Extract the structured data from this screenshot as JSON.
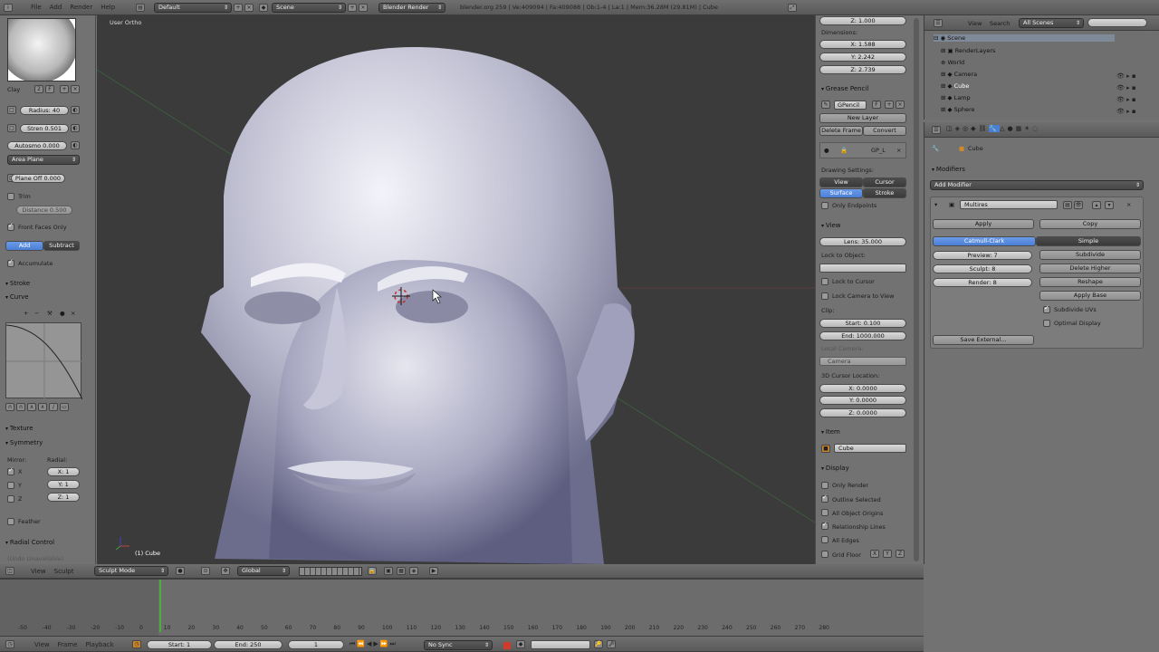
{
  "info_bar": {
    "menus": [
      "File",
      "Add",
      "Render",
      "Help"
    ],
    "layout": "Default",
    "scene": "Scene",
    "engine": "Blender Render",
    "stats": "blender.org 259 | Ve:409094 | Fa:409088 | Ob:1-4 | La:1 | Mem:36.28M (29.81M) | Cube"
  },
  "tool_shelf": {
    "brush": "Clay",
    "brush_users": "2",
    "brush_f": "F",
    "radius": "Radius: 40",
    "strength": "Stren 0.501",
    "autosmooth": "Autosmo 0.000",
    "sculpt_plane": "Area Plane",
    "plane_offset": "Plane Off 0.000",
    "trim": "Trim",
    "trim_distance": "Distance 0.500",
    "front_faces_only": "Front Faces Only",
    "add": "Add",
    "subtract": "Subtract",
    "accumulate": "Accumulate",
    "stroke": "Stroke",
    "curve": "Curve",
    "texture": "Texture",
    "symmetry": "Symmetry",
    "mirror": "Mirror:",
    "radial": "Radial:",
    "axes": [
      "X",
      "Y",
      "Z"
    ],
    "radial_values": [
      "X: 1",
      "Y: 1",
      "Z: 1"
    ],
    "feather": "Feather",
    "radial_control": "Radial Control",
    "undo_hint": "(Undo Unavailable)"
  },
  "viewport": {
    "view_label": "User Ortho",
    "object_label": "(1) Cube"
  },
  "properties": {
    "z_location": "Z: 1.000",
    "dimensions": "Dimensions:",
    "dim_x": "X: 1.588",
    "dim_y": "Y: 2.242",
    "dim_z": "Z: 2.739",
    "grease_pencil": "Grease Pencil",
    "gpencil": "GPencil",
    "gp_f": "F",
    "new_layer": "New Layer",
    "delete_frame": "Delete Frame",
    "convert": "Convert",
    "gp_layer": "GP_L",
    "drawing_settings": "Drawing Settings:",
    "view_btn": "View",
    "cursor_btn": "Cursor",
    "surface_btn": "Surface",
    "stroke_btn": "Stroke",
    "only_endpoints": "Only Endpoints",
    "view_section": "View",
    "lens": "Lens: 35.000",
    "lock_to_object": "Lock to Object:",
    "lock_to_cursor": "Lock to Cursor",
    "lock_camera": "Lock Camera to View",
    "clip": "Clip:",
    "clip_start": "Start: 0.100",
    "clip_end": "End: 1000.000",
    "local_camera": "Local Camera:",
    "camera": "Camera",
    "cursor_location": "3D Cursor Location:",
    "cur_x": "X: 0.0000",
    "cur_y": "Y: 0.0000",
    "cur_z": "Z: 0.0000",
    "item": "Item",
    "item_name": "Cube",
    "display": "Display",
    "only_render": "Only Render",
    "outline_selected": "Outline Selected",
    "all_object_origins": "All Object Origins",
    "relationship_lines": "Relationship Lines",
    "all_edges": "All Edges",
    "grid_floor": "Grid Floor",
    "grid_axes": [
      "X",
      "Y",
      "Z"
    ]
  },
  "outliner": {
    "view": "View",
    "search": "Search",
    "filter": "All Scenes",
    "items": [
      "Scene",
      "RenderLayers",
      "World",
      "Camera",
      "Cube",
      "Lamp",
      "Sphere"
    ]
  },
  "modifiers": {
    "object": "Cube",
    "title": "Modifiers",
    "add_modifier": "Add Modifier",
    "name": "Multires",
    "apply": "Apply",
    "copy": "Copy",
    "catmull": "Catmull-Clark",
    "simple": "Simple",
    "preview": "Preview: 7",
    "sculpt": "Sculpt: 8",
    "render": "Render: 8",
    "subdivide": "Subdivide",
    "delete_higher": "Delete Higher",
    "reshape": "Reshape",
    "apply_base": "Apply Base",
    "subdivide_uvs": "Subdivide UVs",
    "optimal_display": "Optimal Display",
    "save_external": "Save External..."
  },
  "viewport_header": {
    "menus": [
      "View",
      "Sculpt"
    ],
    "mode": "Sculpt Mode",
    "orientation": "Global"
  },
  "timeline": {
    "ticks": [
      "-50",
      "-40",
      "-30",
      "-20",
      "-10",
      "0",
      "10",
      "20",
      "30",
      "40",
      "50",
      "60",
      "70",
      "80",
      "90",
      "100",
      "110",
      "120",
      "130",
      "140",
      "150",
      "160",
      "170",
      "180",
      "190",
      "200",
      "210",
      "220",
      "230",
      "240",
      "250",
      "260",
      "270",
      "280"
    ],
    "menus": [
      "View",
      "Frame",
      "Playback"
    ],
    "start": "Start: 1",
    "end": "End: 250",
    "current": "1",
    "sync": "No Sync"
  },
  "colors": {
    "accent": "#4a7fd6",
    "panel": "#727272",
    "viewport": "#3a3a3a"
  }
}
